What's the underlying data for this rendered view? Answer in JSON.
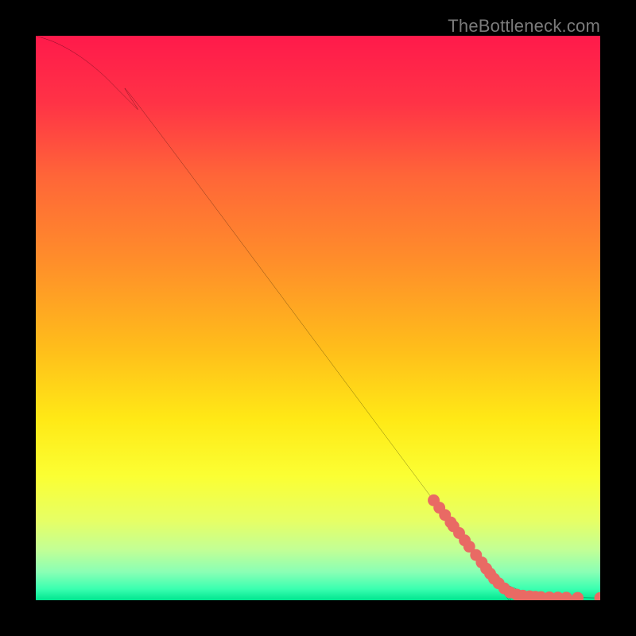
{
  "watermark": "TheBottleneck.com",
  "chart_data": {
    "type": "line",
    "title": "",
    "xlabel": "",
    "ylabel": "",
    "xlim": [
      0,
      100
    ],
    "ylim": [
      0,
      100
    ],
    "grid": false,
    "legend": false,
    "annotations": [],
    "series": [
      {
        "name": "curve",
        "color": "#000000",
        "style": "line",
        "x": [
          0,
          3,
          6,
          9,
          12,
          15,
          18,
          21,
          80,
          82,
          84,
          86,
          88,
          90,
          92,
          94,
          96,
          98,
          100
        ],
        "y": [
          100,
          99,
          97.5,
          95.5,
          93,
          90,
          87,
          84,
          5,
          3.5,
          2.5,
          1.7,
          1.2,
          0.9,
          0.7,
          0.55,
          0.47,
          0.43,
          0.4
        ]
      },
      {
        "name": "highlighted-points",
        "color": "#e96a64",
        "style": "scatter",
        "x": [
          70.5,
          71.5,
          72.5,
          73.5,
          74.0,
          75.0,
          76.0,
          76.8,
          78.0,
          79.0,
          79.8,
          80.5,
          81.2,
          82.0,
          83.0,
          84.0,
          85.2,
          86.3,
          87.5,
          88.5,
          89.5,
          91.0,
          92.5,
          94.0,
          96.0,
          100.0
        ],
        "y": [
          17.7,
          16.4,
          15.1,
          13.8,
          13.1,
          11.9,
          10.6,
          9.5,
          8.0,
          6.7,
          5.6,
          4.7,
          3.8,
          3.0,
          2.1,
          1.4,
          1.0,
          0.8,
          0.7,
          0.6,
          0.55,
          0.5,
          0.47,
          0.44,
          0.42,
          0.4
        ]
      }
    ],
    "background_gradient": {
      "type": "vertical",
      "stops": [
        {
          "pos": 0.0,
          "color": "#ff1a4b"
        },
        {
          "pos": 0.12,
          "color": "#ff3346"
        },
        {
          "pos": 0.25,
          "color": "#ff6638"
        },
        {
          "pos": 0.4,
          "color": "#ff8e2a"
        },
        {
          "pos": 0.55,
          "color": "#ffbc1b"
        },
        {
          "pos": 0.68,
          "color": "#ffe916"
        },
        {
          "pos": 0.78,
          "color": "#fbff33"
        },
        {
          "pos": 0.86,
          "color": "#e6ff66"
        },
        {
          "pos": 0.91,
          "color": "#c3ff95"
        },
        {
          "pos": 0.95,
          "color": "#8affb5"
        },
        {
          "pos": 0.98,
          "color": "#3affb0"
        },
        {
          "pos": 1.0,
          "color": "#00e58f"
        }
      ]
    }
  }
}
